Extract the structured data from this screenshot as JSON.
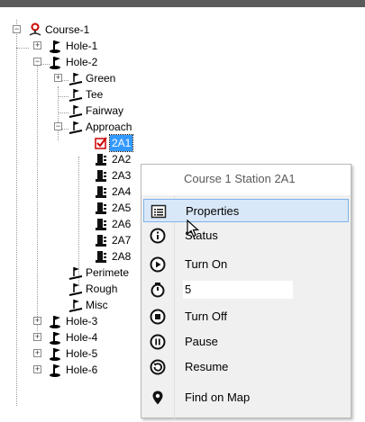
{
  "tree": {
    "course": "Course-1",
    "hole1": "Hole-1",
    "hole2": "Hole-2",
    "green": "Green",
    "tee": "Tee",
    "fairway": "Fairway",
    "approach": "Approach",
    "stations": [
      "2A1",
      "2A2",
      "2A3",
      "2A4",
      "2A5",
      "2A6",
      "2A7",
      "2A8"
    ],
    "perimeter": "Perimete",
    "rough": "Rough",
    "misc": "Misc",
    "hole3": "Hole-3",
    "hole4": "Hole-4",
    "hole5": "Hole-5",
    "hole6": "Hole-6"
  },
  "context_menu": {
    "title": "Course 1 Station 2A1",
    "items": [
      {
        "label": "Properties",
        "icon": "list-icon"
      },
      {
        "label": "Status",
        "icon": "info-icon"
      },
      {
        "label": "Turn On",
        "icon": "play-icon"
      },
      {
        "label": "5",
        "icon": "timer-icon"
      },
      {
        "label": "Turn Off",
        "icon": "stop-icon"
      },
      {
        "label": "Pause",
        "icon": "pause-icon"
      },
      {
        "label": "Resume",
        "icon": "resume-icon"
      },
      {
        "label": "Find on Map",
        "icon": "map-pin-icon"
      }
    ]
  },
  "colors": {
    "selection": "#3399ff",
    "menu_hover": "#d9e8f8",
    "hover_border": "#7eb4ea",
    "title_bar": "#5b5b5b"
  }
}
